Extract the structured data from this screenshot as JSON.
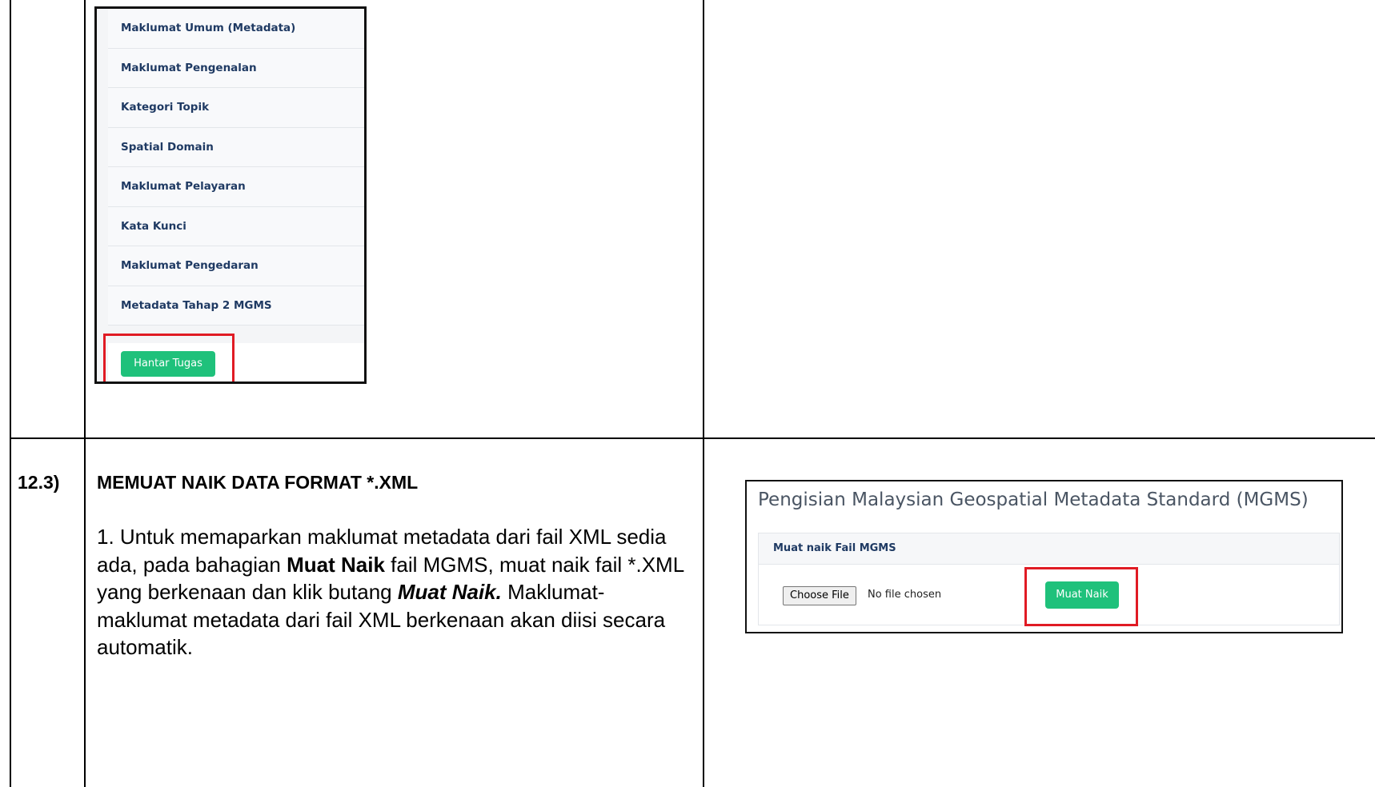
{
  "task_menu": {
    "items": [
      "Maklumat Umum (Metadata)",
      "Maklumat Pengenalan",
      "Kategori Topik",
      "Spatial Domain",
      "Maklumat Pelayaran",
      "Kata Kunci",
      "Maklumat Pengedaran",
      "Metadata Tahap 2 MGMS"
    ],
    "submit_label": "Hantar Tugas"
  },
  "section": {
    "number": "12.3)",
    "title": "MEMUAT NAIK DATA FORMAT *.XML",
    "step_intro": "1. Untuk memaparkan maklumat metadata dari fail XML sedia ada, pada bahagian ",
    "step_bold": "Muat Naik",
    "step_mid": " fail MGMS, muat naik fail *.XML yang berkenaan dan klik butang ",
    "step_bold_italic": "Muat Naik.",
    "step_end": " Maklumat-maklumat metadata dari fail XML berkenaan akan diisi secara automatik."
  },
  "upload_panel": {
    "title": "Pengisian Malaysian Geospatial Metadata Standard (MGMS)",
    "card_header": "Muat naik Fail MGMS",
    "choose_file_label": "Choose File",
    "no_file_text": "No file chosen",
    "upload_button_label": "Muat Naik"
  },
  "colors": {
    "highlight": "#e01b24",
    "button_green": "#1fc17b",
    "menu_text": "#1f3a63"
  }
}
